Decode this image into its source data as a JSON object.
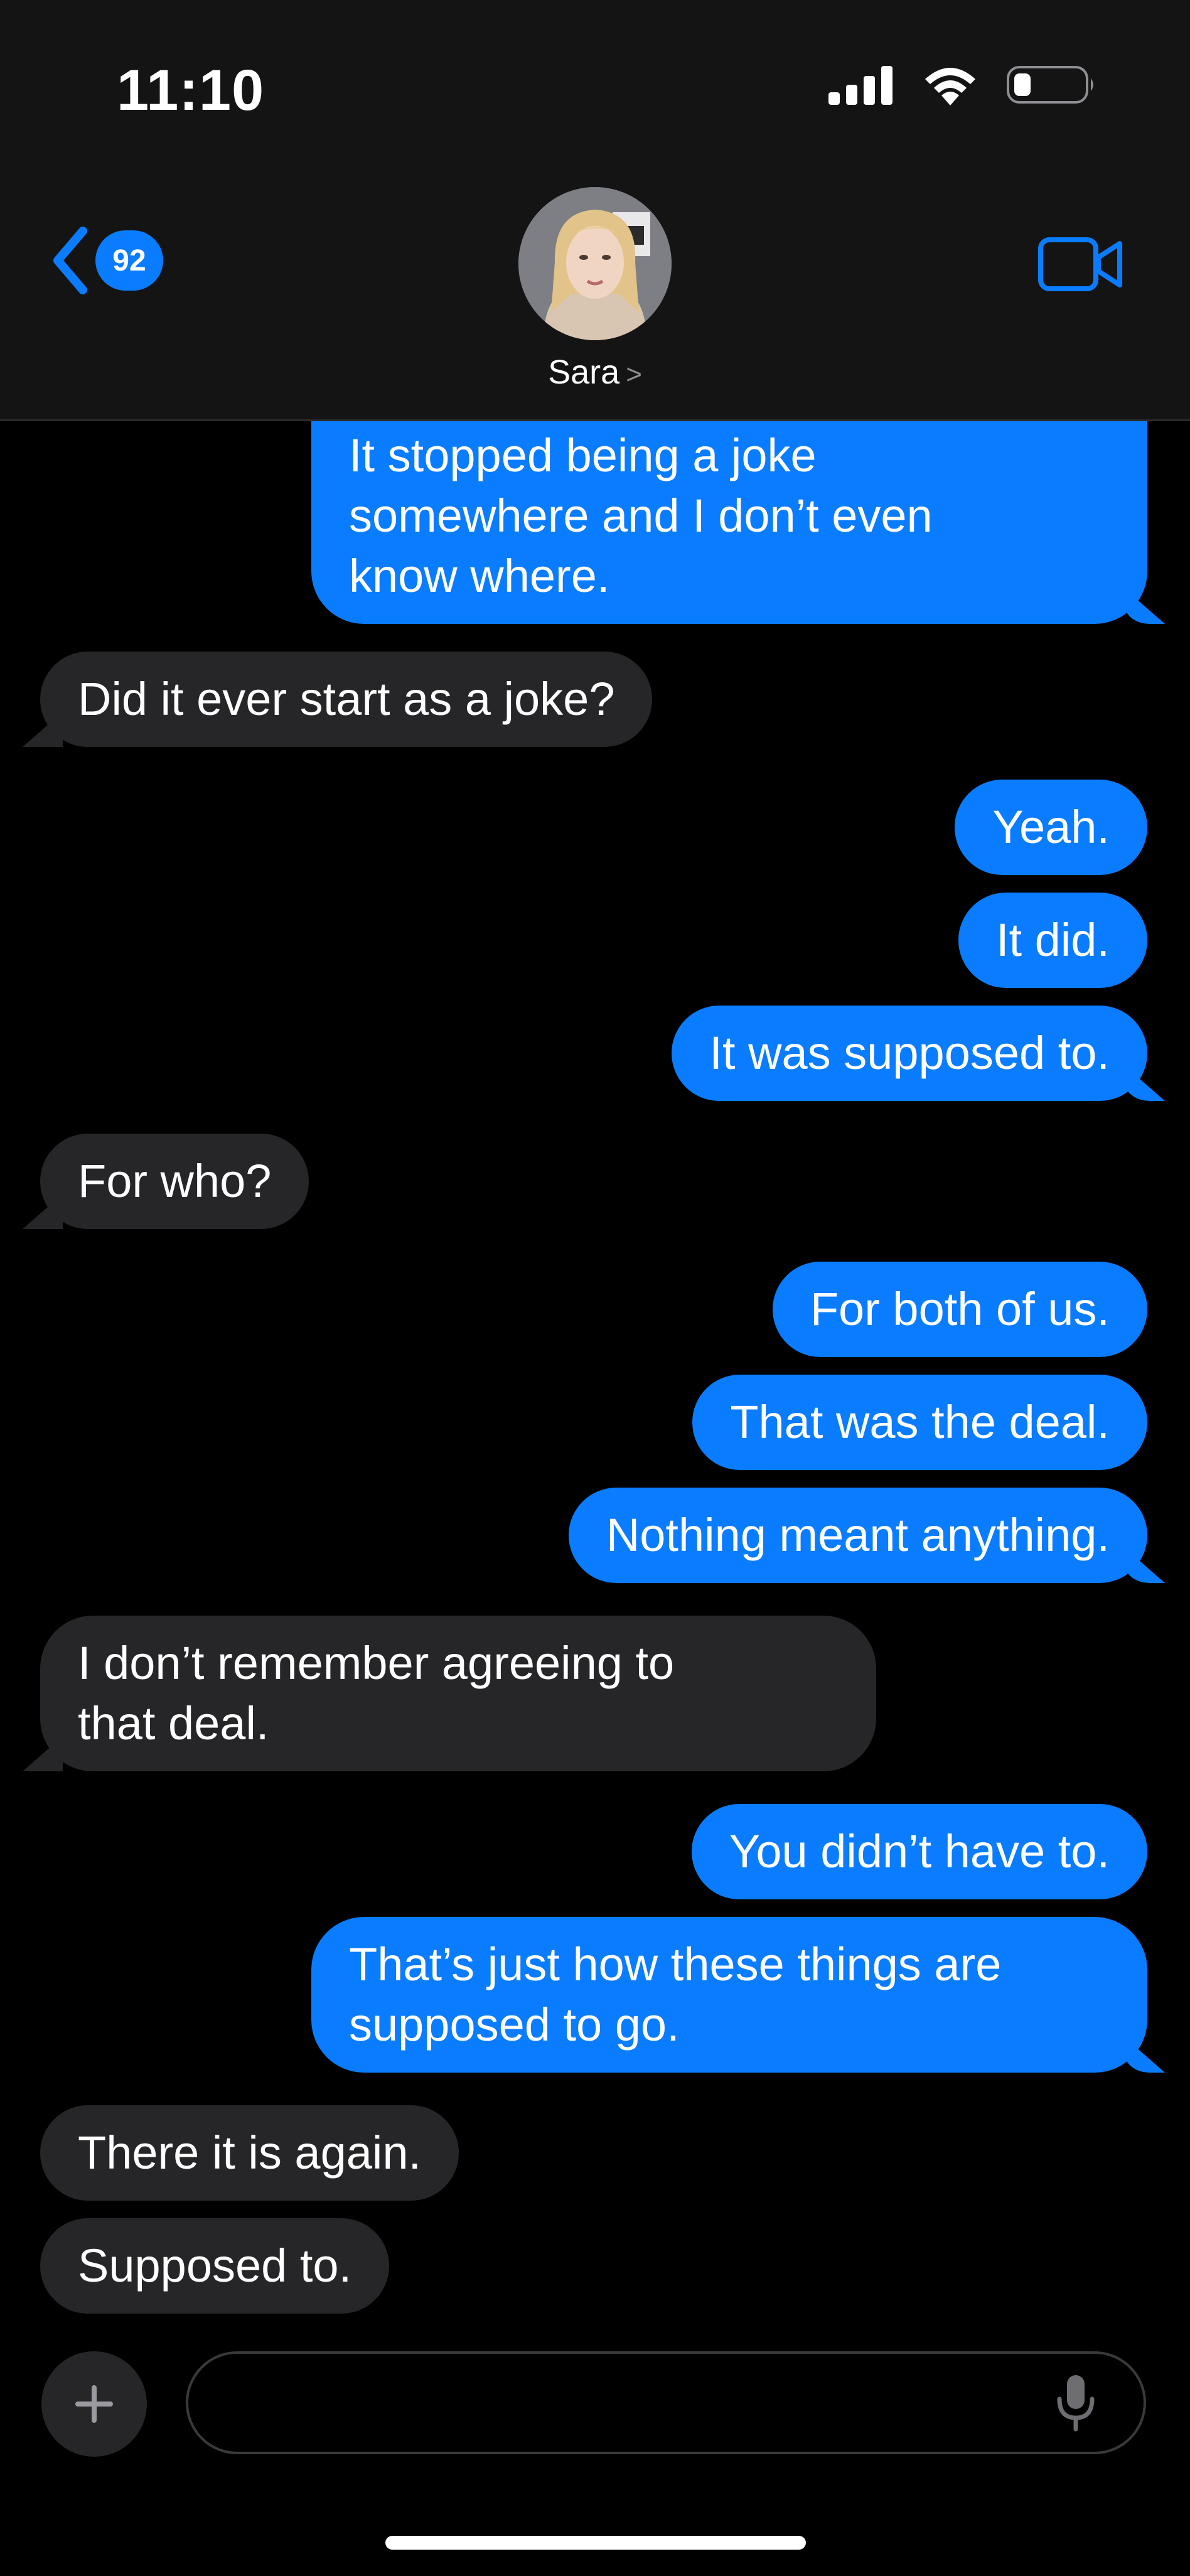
{
  "status_bar": {
    "time": "11:10",
    "icons": [
      "cellular-signal-icon",
      "wifi-icon",
      "battery-icon"
    ]
  },
  "header": {
    "back_count": "92",
    "contact_name": "Sara",
    "chevron": ">",
    "icons": [
      "back-chevron-icon",
      "video-camera-icon",
      "chevron-right-icon"
    ]
  },
  "messages": [
    {
      "dir": "out",
      "text": "It stopped being a joke\nsomewhere and I don’t even\nknow where."
    },
    {
      "dir": "in",
      "text": "Did it ever start as a joke?"
    },
    {
      "dir": "out",
      "text": "Yeah."
    },
    {
      "dir": "out",
      "text": "It did."
    },
    {
      "dir": "out",
      "text": "It was supposed to."
    },
    {
      "dir": "in",
      "text": "For who?"
    },
    {
      "dir": "out",
      "text": "For both of us."
    },
    {
      "dir": "out",
      "text": "That was the deal."
    },
    {
      "dir": "out",
      "text": "Nothing meant anything."
    },
    {
      "dir": "in",
      "text": "I don’t remember agreeing to\nthat deal."
    },
    {
      "dir": "out",
      "text": "You didn’t have to."
    },
    {
      "dir": "out",
      "text": "That’s just how these things are\nsupposed to go."
    },
    {
      "dir": "in",
      "text": "There it is again."
    },
    {
      "dir": "in",
      "text": "Supposed to."
    }
  ],
  "composer": {
    "placeholder": "",
    "icons": [
      "plus-icon",
      "microphone-icon"
    ]
  },
  "colors": {
    "outgoing_bubble": "#0a7cff",
    "incoming_bubble": "#262629",
    "background": "#000000",
    "header_background": "#141414"
  }
}
